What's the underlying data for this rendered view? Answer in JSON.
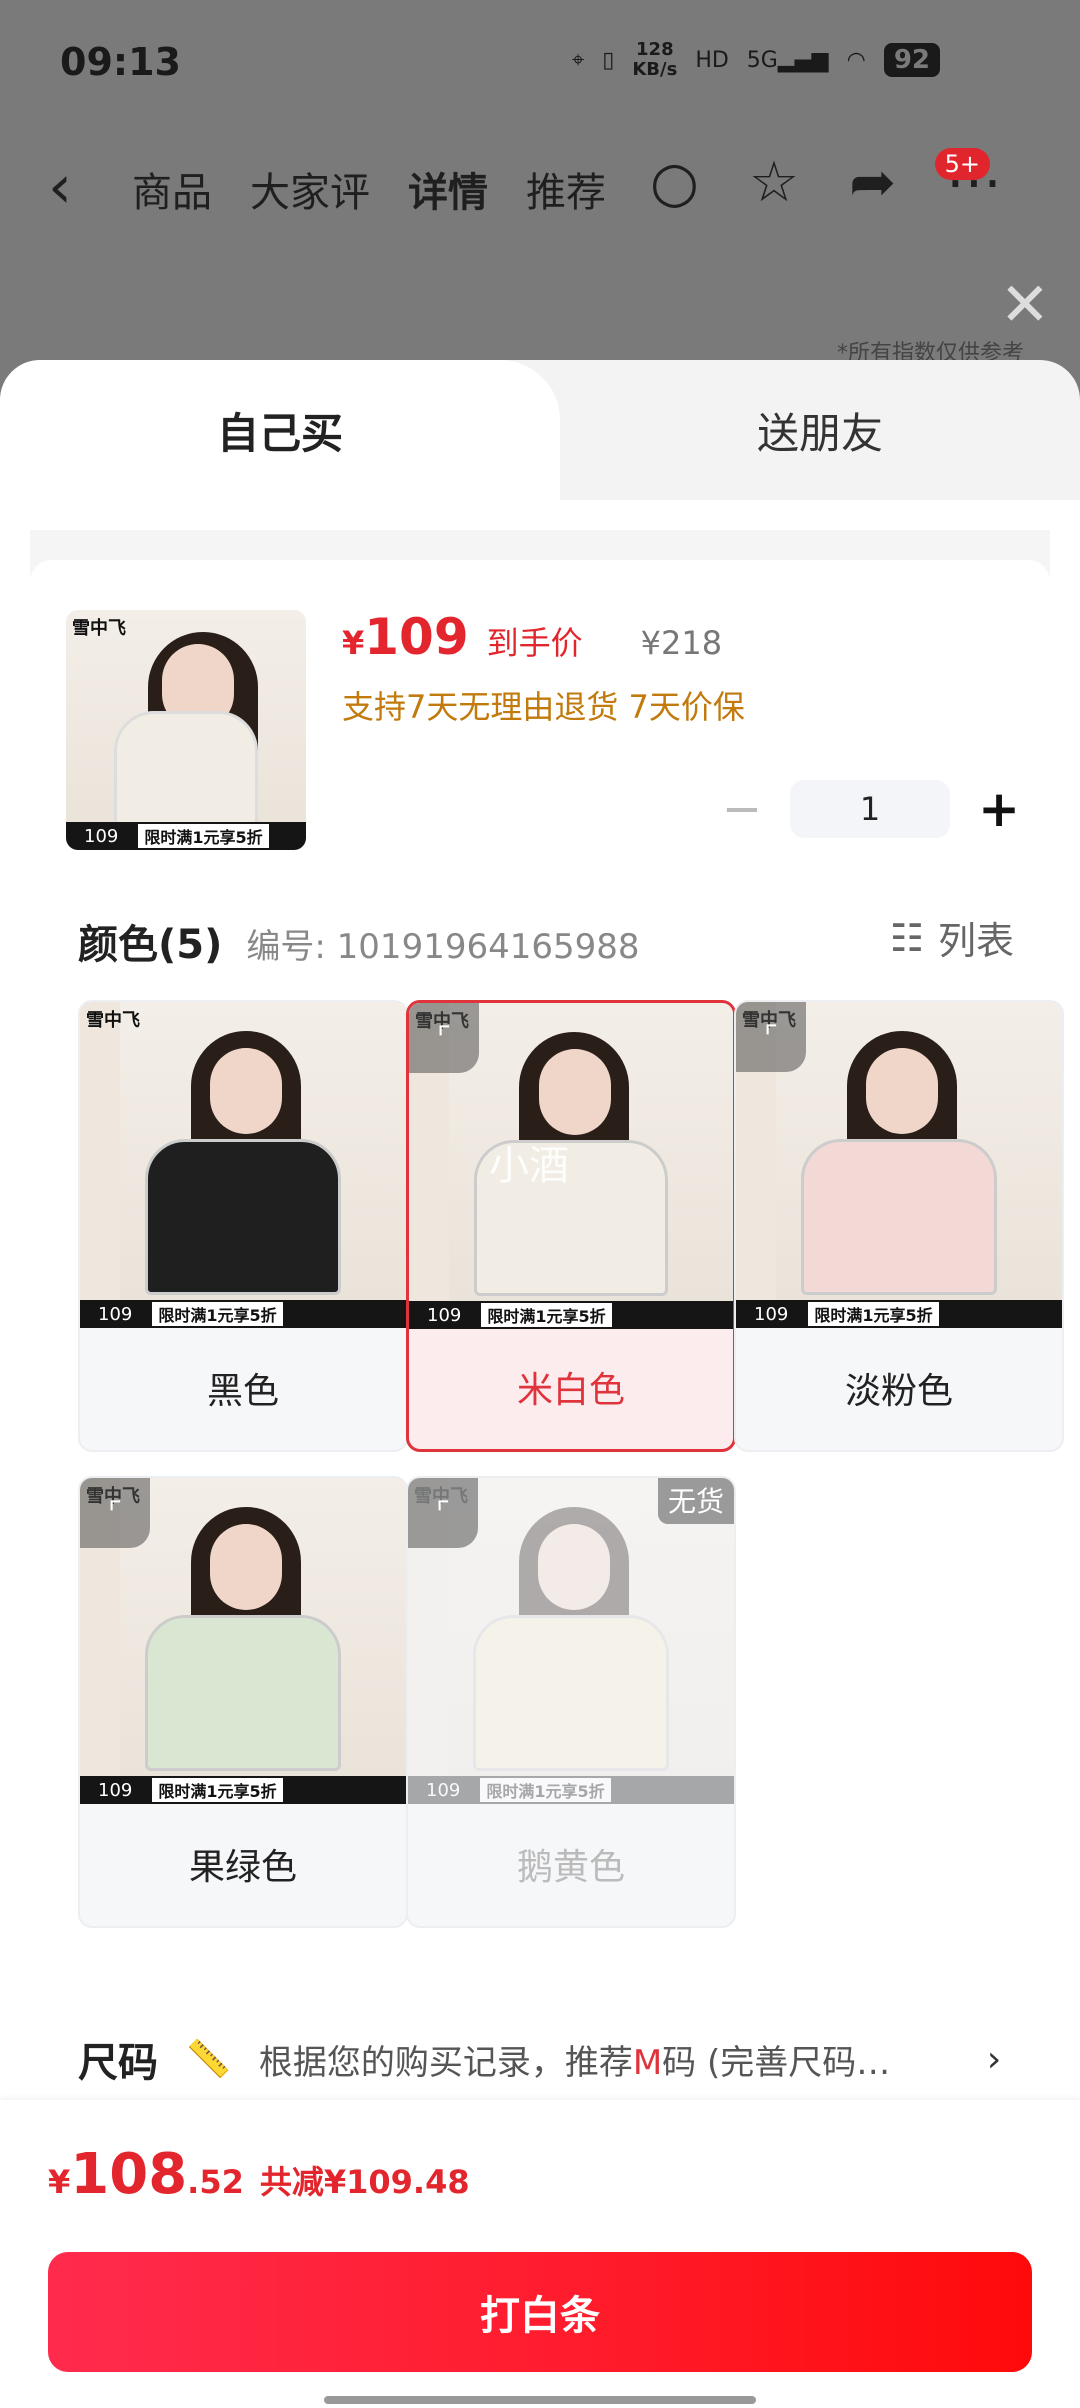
{
  "status_bar": {
    "time": "09:13",
    "net_speed_top": "128",
    "net_speed_unit": "KB/s",
    "hd": "HD",
    "signal": "5G",
    "battery": "92"
  },
  "nav": {
    "tabs": [
      "商品",
      "大家评",
      "详情",
      "推荐"
    ],
    "badge": "5+"
  },
  "hint_text": "*所有指数仅供参考",
  "sheet": {
    "tab_self": "自己买",
    "tab_friend": "送朋友"
  },
  "product": {
    "price_symbol": "¥",
    "price": "109",
    "price_tag": "到手价",
    "original_price": "¥218",
    "policy": "支持7天无理由退货  7天价保",
    "quantity": "1",
    "minus": "−",
    "plus": "+"
  },
  "colors": {
    "title": "颜色(5)",
    "sku": "编号: 10191964165988",
    "list_label": "列表",
    "items": [
      {
        "label": "黑色",
        "jacket_color": "#1f1f1f",
        "selected": false,
        "disabled": false
      },
      {
        "label": "米白色",
        "jacket_color": "#f1ede4",
        "selected": true,
        "disabled": false
      },
      {
        "label": "淡粉色",
        "jacket_color": "#f3d9d6",
        "selected": false,
        "disabled": false
      },
      {
        "label": "果绿色",
        "jacket_color": "#d9e6d2",
        "selected": false,
        "disabled": false
      },
      {
        "label": "鹅黄色",
        "jacket_color": "#f4ead0",
        "selected": false,
        "disabled": true
      }
    ],
    "soldout_label": "无货",
    "photo_logo": "雪中飞",
    "photo_price": "109",
    "photo_promo": "限时满1元享5折",
    "watermark": "小酒"
  },
  "size": {
    "title": "尺码",
    "rec_prefix": "根据您的购买记录，推荐",
    "rec_m": "M",
    "rec_suffix": "码 (完善尺码…",
    "chevron": "›"
  },
  "footer": {
    "currency": "¥",
    "total_int": "108",
    "total_dec": ".52",
    "discount": "共减¥109.48",
    "button": "打白条"
  }
}
